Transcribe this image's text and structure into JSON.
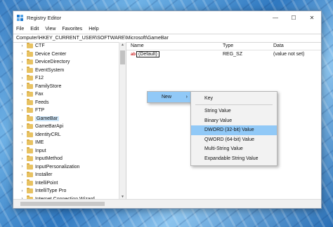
{
  "window": {
    "title": "Registry Editor",
    "controls": {
      "minimize": "—",
      "maximize": "☐",
      "close": "✕"
    }
  },
  "menubar": [
    "File",
    "Edit",
    "View",
    "Favorites",
    "Help"
  ],
  "address": "Computer\\HKEY_CURRENT_USER\\SOFTWARE\\Microsoft\\GameBar",
  "tree": {
    "items": [
      {
        "label": "CTF",
        "expandable": true
      },
      {
        "label": "Device Center",
        "expandable": true
      },
      {
        "label": "DeviceDirectory",
        "expandable": true
      },
      {
        "label": "EventSystem",
        "expandable": true
      },
      {
        "label": "F12",
        "expandable": true
      },
      {
        "label": "FamilyStore",
        "expandable": true
      },
      {
        "label": "Fax",
        "expandable": true
      },
      {
        "label": "Feeds",
        "expandable": false
      },
      {
        "label": "FTP",
        "expandable": true
      },
      {
        "label": "GameBar",
        "expandable": false,
        "selected": true
      },
      {
        "label": "GameBarApi",
        "expandable": true
      },
      {
        "label": "IdentityCRL",
        "expandable": true
      },
      {
        "label": "IME",
        "expandable": true
      },
      {
        "label": "Input",
        "expandable": true
      },
      {
        "label": "InputMethod",
        "expandable": true
      },
      {
        "label": "InputPersonalization",
        "expandable": true
      },
      {
        "label": "Installer",
        "expandable": true
      },
      {
        "label": "IntelliPoint",
        "expandable": true
      },
      {
        "label": "IntelliType Pro",
        "expandable": true
      },
      {
        "label": "Internet Connection Wizard",
        "expandable": true
      }
    ]
  },
  "list": {
    "columns": [
      "Name",
      "Type",
      "Data"
    ],
    "rows": [
      {
        "icon": "ab",
        "name": "(Default)",
        "type": "REG_SZ",
        "data": "(value not set)"
      }
    ]
  },
  "context_menu": {
    "new_label": "New",
    "arrow": "›",
    "submenu": [
      {
        "label": "Key"
      },
      {
        "separator": true
      },
      {
        "label": "String Value"
      },
      {
        "label": "Binary Value"
      },
      {
        "label": "DWORD (32-bit) Value",
        "highlighted": true
      },
      {
        "label": "QWORD (64-bit) Value"
      },
      {
        "label": "Multi-String Value"
      },
      {
        "label": "Expandable String Value"
      }
    ]
  }
}
